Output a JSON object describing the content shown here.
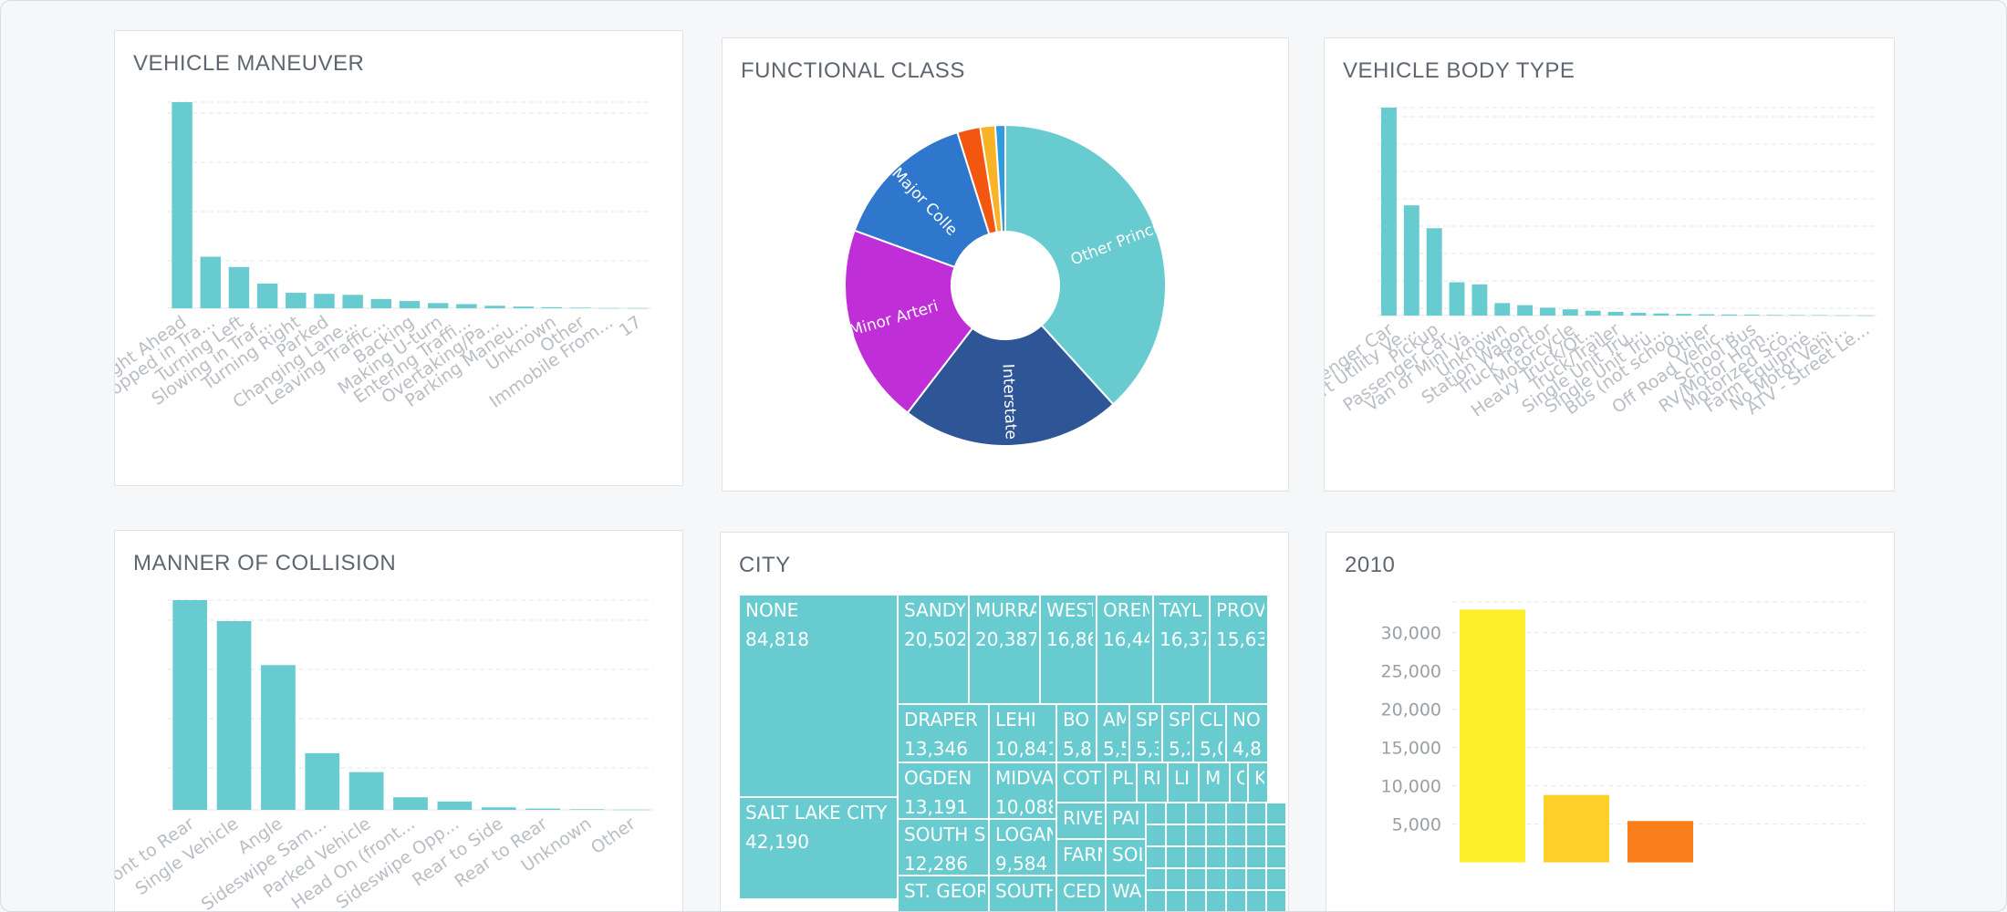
{
  "colors": {
    "teal": "#67cbd0",
    "grid": "#e3e5e8",
    "pie": [
      "#67cbd0",
      "#2e5595",
      "#c02ed8",
      "#2f77cc",
      "#f2560f",
      "#f9b327",
      "#2f9be0"
    ],
    "year_bars": [
      "#fdf02b",
      "#fdcf2a",
      "#fb7e1c"
    ]
  },
  "panels": {
    "maneuver": {
      "title": "VEHICLE MANEUVER"
    },
    "functional": {
      "title": "FUNCTIONAL CLASS"
    },
    "body": {
      "title": "VEHICLE BODY TYPE"
    },
    "collision": {
      "title": "MANNER OF COLLISION"
    },
    "city": {
      "title": "CITY"
    },
    "year": {
      "title": "2010"
    }
  },
  "chart_data": [
    {
      "id": "maneuver",
      "type": "bar",
      "title": "VEHICLE MANEUVER",
      "categories": [
        "Straight Ahead",
        "Stopped in Tra...",
        "Turning Left",
        "Slowing in Traf...",
        "Turning Right",
        "Parked",
        "Changing Lane...",
        "Leaving Traffic...",
        "Backing",
        "Making U-turn",
        "Entering Traffi...",
        "Overtaking/Pa...",
        "Parking Maneu...",
        "Unknown",
        "Other",
        "Immobile From...",
        "17"
      ],
      "values": [
        100,
        25,
        20,
        12,
        7.5,
        7,
        6.5,
        4.5,
        3.5,
        2.5,
        2,
        1.2,
        0.8,
        0.5,
        0.3,
        0.1,
        0.05
      ],
      "ylim": [
        0,
        100
      ],
      "grid": true
    },
    {
      "id": "functional",
      "type": "pie",
      "title": "FUNCTIONAL CLASS",
      "slices": [
        {
          "label": "Other Princi",
          "value": 38
        },
        {
          "label": "Interstate",
          "value": 22
        },
        {
          "label": "Minor Arteri",
          "value": 20
        },
        {
          "label": "Major Colle",
          "value": 14.5
        },
        {
          "label": "",
          "value": 2.3
        },
        {
          "label": "",
          "value": 1.5
        },
        {
          "label": "",
          "value": 1.0
        }
      ]
    },
    {
      "id": "body",
      "type": "bar",
      "title": "VEHICLE BODY TYPE",
      "categories": [
        "Passenger Car",
        "Sport Utility Ve...",
        "Pickup",
        "Passenger Car...",
        "Van or Mini Va...",
        "Unknown",
        "Station Wagon",
        "Truck Tractor",
        "Motorcycle",
        "Heavy Truck/Ot...",
        "Truck/Trailer",
        "Single Unit Tru...",
        "Single Unit Tru...",
        "Bus (not schoo...",
        "Other",
        "Off Road Vehic...",
        "School Bus",
        "RV/Motor Hom...",
        "Motorized Sco...",
        "Farm Equipme...",
        "No Motor Vehi...",
        "ATV - Street Le..."
      ],
      "values": [
        100,
        53,
        42,
        16,
        15,
        6,
        5,
        3.8,
        3,
        2.3,
        1.8,
        1.3,
        1,
        0.8,
        0.6,
        0.5,
        0.4,
        0.3,
        0.25,
        0.2,
        0.1,
        0.05
      ],
      "ylim": [
        0,
        100
      ],
      "grid": true
    },
    {
      "id": "collision",
      "type": "bar",
      "title": "MANNER OF COLLISION",
      "categories": [
        "Front to Rear",
        "Single Vehicle",
        "Angle",
        "Sideswipe Sam...",
        "Parked Vehicle",
        "Head On (front...",
        "Sideswipe Opp...",
        "Rear to Side",
        "Rear to Rear",
        "Unknown",
        "Other"
      ],
      "values": [
        100,
        90,
        69,
        27,
        18,
        6,
        4,
        1.2,
        0.6,
        0.3,
        0.1
      ],
      "ylim": [
        0,
        100
      ],
      "grid": true
    },
    {
      "id": "city",
      "type": "treemap",
      "title": "CITY",
      "items": [
        {
          "name": "NONE",
          "value": "84,818"
        },
        {
          "name": "SALT LAKE CITY",
          "value": "42,190"
        },
        {
          "name": "SANDY",
          "value": "20,502"
        },
        {
          "name": "MURRA",
          "value": "20,387"
        },
        {
          "name": "WEST",
          "value": "16,86"
        },
        {
          "name": "OREM",
          "value": "16,44"
        },
        {
          "name": "TAYL",
          "value": "16,37"
        },
        {
          "name": "PROV",
          "value": "15,63"
        },
        {
          "name": "DRAPER",
          "value": "13,346"
        },
        {
          "name": "OGDEN",
          "value": "13,191"
        },
        {
          "name": "SOUTH S",
          "value": "12,286"
        },
        {
          "name": "ST. GEOR",
          "value": ""
        },
        {
          "name": "LEHI",
          "value": "10,841"
        },
        {
          "name": "MIDVA",
          "value": "10,088"
        },
        {
          "name": "LOGAN",
          "value": "9,584"
        },
        {
          "name": "SOUTH",
          "value": ""
        },
        {
          "name": "BO",
          "value": "5,8"
        },
        {
          "name": "AM",
          "value": "5,5"
        },
        {
          "name": "SP",
          "value": "5,3"
        },
        {
          "name": "SP",
          "value": "5,2"
        },
        {
          "name": "CL",
          "value": "5,0"
        },
        {
          "name": "NO",
          "value": "4,8"
        },
        {
          "name": "COT",
          "value": ""
        },
        {
          "name": "RIVE",
          "value": ""
        },
        {
          "name": "FARM",
          "value": ""
        },
        {
          "name": "CED",
          "value": ""
        },
        {
          "name": "PL",
          "value": ""
        },
        {
          "name": "RI",
          "value": ""
        },
        {
          "name": "LI",
          "value": ""
        },
        {
          "name": "M",
          "value": ""
        },
        {
          "name": "CI",
          "value": ""
        },
        {
          "name": "KA",
          "value": ""
        },
        {
          "name": "PAI",
          "value": ""
        },
        {
          "name": "SOL",
          "value": ""
        },
        {
          "name": "WA",
          "value": ""
        }
      ]
    },
    {
      "id": "year",
      "type": "bar",
      "title": "2010",
      "categories": [
        "",
        "",
        ""
      ],
      "values": [
        33000,
        8800,
        5400
      ],
      "yticks": [
        "5,000",
        "10,000",
        "15,000",
        "20,000",
        "25,000",
        "30,000"
      ],
      "ylim": [
        0,
        34000
      ],
      "grid": true
    }
  ]
}
